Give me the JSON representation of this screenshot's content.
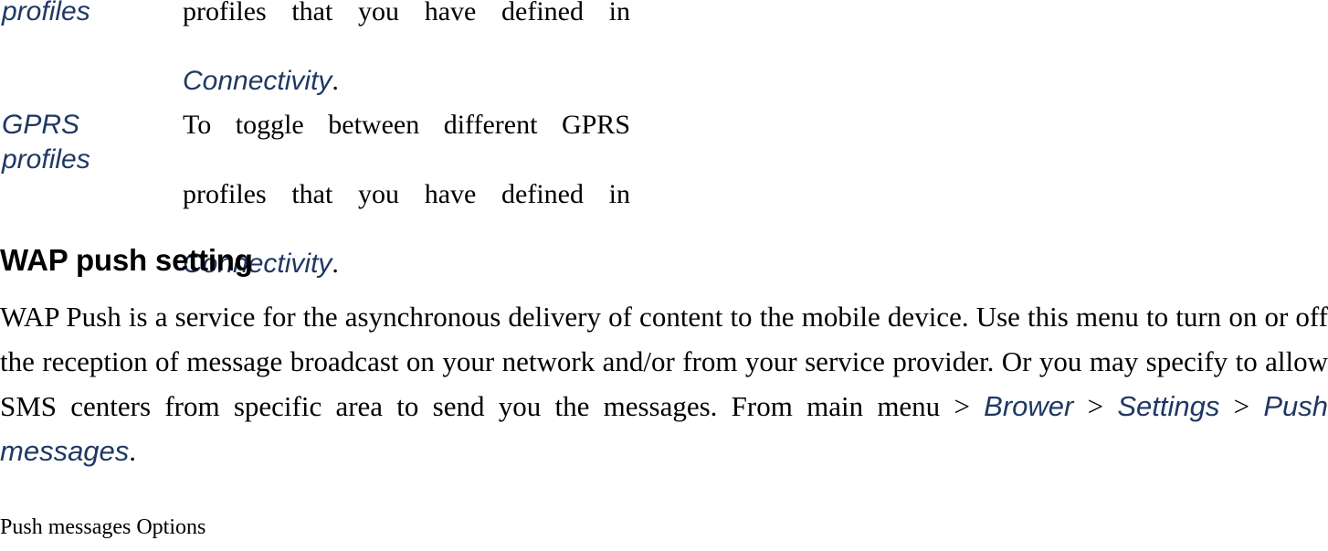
{
  "document": {
    "definition_table": {
      "rows": [
        {
          "term": "profiles",
          "desc_line1": "profiles that you have defined in",
          "desc_term": "Connectivity",
          "desc_period": "."
        },
        {
          "term_line1": "GPRS",
          "term_line2": "profiles",
          "desc_line1": "To toggle between different GPRS",
          "desc_line2": "profiles that you have defined in",
          "desc_term": "Connectivity",
          "desc_period": "."
        }
      ]
    },
    "section": {
      "heading": "WAP push setting",
      "paragraph": {
        "part1": "WAP Push is a service for the asynchronous delivery of content to the mobile device. Use this menu to turn on or off the reception of message broadcast on your network and/or from your service provider. Or you may specify to allow SMS centers from specific area to send you the messages. From main menu ",
        "sep1": ">",
        "nav1": "Brower",
        "sep2": ">",
        "nav2": "Settings",
        "sep3": ">",
        "nav3": "Push messages",
        "period": "."
      }
    },
    "caption": "Push messages Options"
  }
}
